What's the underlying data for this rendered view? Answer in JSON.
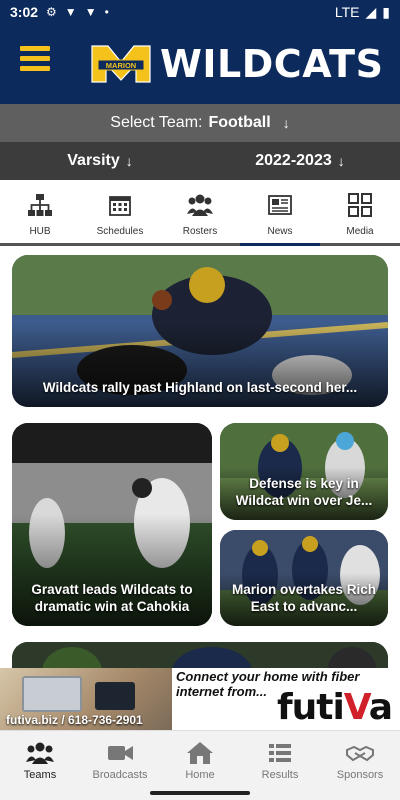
{
  "status_bar": {
    "time": "3:02",
    "network": "LTE"
  },
  "header": {
    "logo_letter": "M",
    "logo_school": "MARION",
    "title": "WILDCATS"
  },
  "team_select": {
    "label": "Select Team:",
    "value": "Football"
  },
  "level_select": {
    "value": "Varsity"
  },
  "season_select": {
    "value": "2022-2023"
  },
  "tabs": [
    {
      "label": "HUB",
      "icon": "hierarchy-icon"
    },
    {
      "label": "Schedules",
      "icon": "calendar-icon"
    },
    {
      "label": "Rosters",
      "icon": "people-icon"
    },
    {
      "label": "News",
      "icon": "newspaper-icon",
      "active": true
    },
    {
      "label": "Media",
      "icon": "grid-icon"
    }
  ],
  "news": [
    {
      "title": "Wildcats rally past Highland on last-second her..."
    },
    {
      "title": "Defense is key in Wildcat win over Je..."
    },
    {
      "title": "Gravatt leads Wildcats to dramatic win at Cahokia"
    },
    {
      "title": "Marion overtakes Rich East to advanc..."
    }
  ],
  "ad": {
    "contact": "futiva.biz / 618-736-2901",
    "tagline": "Connect your home with fiber internet from...",
    "brand_start": "futi",
    "brand_accent": "V",
    "brand_end": "a"
  },
  "bottom_nav": [
    {
      "label": "Teams",
      "icon": "teams-icon",
      "active": true
    },
    {
      "label": "Broadcasts",
      "icon": "video-camera-icon"
    },
    {
      "label": "Home",
      "icon": "home-icon"
    },
    {
      "label": "Results",
      "icon": "list-icon"
    },
    {
      "label": "Sponsors",
      "icon": "handshake-icon"
    }
  ],
  "colors": {
    "navy": "#0c2a5b",
    "gold": "#f4c21a",
    "gray_bar": "#5f5f5f",
    "dark_bar": "#3c3c3c",
    "accent_red": "#d0202a"
  }
}
